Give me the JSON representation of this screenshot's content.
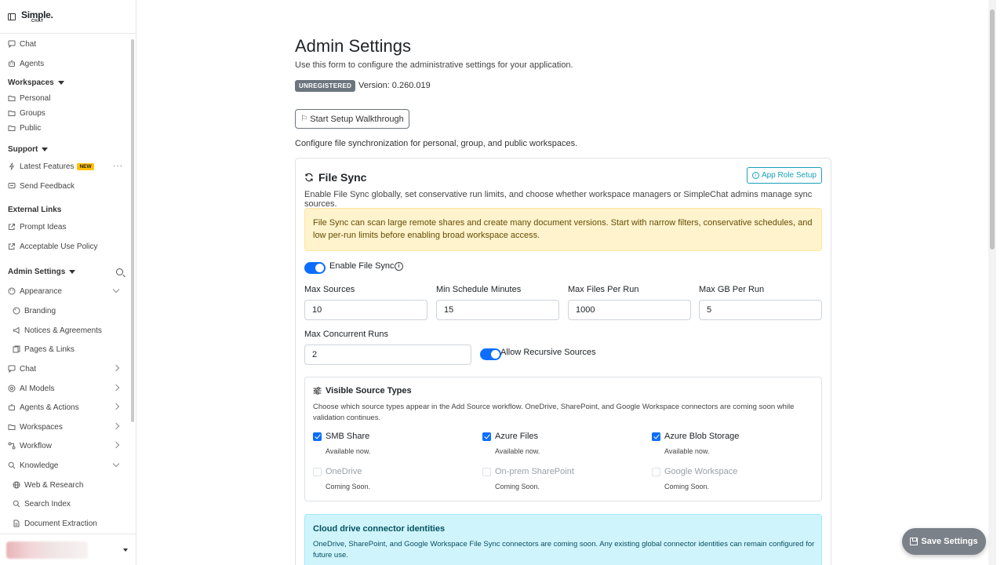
{
  "brand": {
    "line1": "Simple.",
    "line2": "CHAT"
  },
  "sidebar": {
    "chat": "Chat",
    "agents": "Agents",
    "workspaces_head": "Workspaces",
    "personal": "Personal",
    "groups": "Groups",
    "public": "Public",
    "support_head": "Support",
    "latest_features": "Latest Features",
    "new_badge": "NEW",
    "more_dots": "···",
    "send_feedback": "Send Feedback",
    "external_head": "External Links",
    "prompt_ideas": "Prompt Ideas",
    "acceptable_use": "Acceptable Use Policy",
    "admin_head": "Admin Settings",
    "appearance": "Appearance",
    "branding": "Branding",
    "notices": "Notices & Agreements",
    "pages_links": "Pages & Links",
    "admin_chat": "Chat",
    "ai_models": "AI Models",
    "agents_actions": "Agents & Actions",
    "admin_workspaces": "Workspaces",
    "workflow": "Workflow",
    "knowledge": "Knowledge",
    "web_research": "Web & Research",
    "search_index": "Search Index",
    "doc_extraction": "Document Extraction"
  },
  "header": {
    "title": "Admin Settings",
    "subtitle": "Use this form to configure the administrative settings for your application.",
    "badge": "UNREGISTERED",
    "version": "Version: 0.260.019",
    "walkthrough": "Start Setup Walkthrough",
    "config_line": "Configure file synchronization for personal, group, and public workspaces."
  },
  "filesync": {
    "title": "File Sync",
    "role_button": "App Role Setup",
    "description": "Enable File Sync globally, set conservative run limits, and choose whether workspace managers or SimpleChat admins manage sync sources.",
    "warning": "File Sync can scan large remote shares and create many document versions. Start with narrow filters, conservative schedules, and low per-run limits before enabling broad workspace access.",
    "enable_label": "Enable File Sync",
    "enabled": true,
    "max_sources_label": "Max Sources",
    "max_sources": "10",
    "min_schedule_label": "Min Schedule Minutes",
    "min_schedule": "15",
    "max_files_label": "Max Files Per Run",
    "max_files": "1000",
    "max_gb_label": "Max GB Per Run",
    "max_gb": "5",
    "max_concurrent_label": "Max Concurrent Runs",
    "max_concurrent": "2",
    "recursive_label": "Allow Recursive Sources",
    "recursive": true
  },
  "source_types": {
    "title": "Visible Source Types",
    "description": "Choose which source types appear in the Add Source workflow. OneDrive, SharePoint, and Google Workspace connectors are coming soon while validation continues.",
    "items": [
      {
        "label": "SMB Share",
        "status": "Available now.",
        "checked": true
      },
      {
        "label": "Azure Files",
        "status": "Available now.",
        "checked": true
      },
      {
        "label": "Azure Blob Storage",
        "status": "Available now.",
        "checked": true
      },
      {
        "label": "OneDrive",
        "status": "Coming Soon.",
        "checked": false
      },
      {
        "label": "On-prem SharePoint",
        "status": "Coming Soon.",
        "checked": false
      },
      {
        "label": "Google Workspace",
        "status": "Coming Soon.",
        "checked": false
      }
    ]
  },
  "cloud": {
    "title": "Cloud drive connector identities",
    "text": "OneDrive, SharePoint, and Google Workspace File Sync connectors are coming soon. Any existing global connector identities can remain configured for future use."
  },
  "save_button": "Save Settings",
  "colors": {
    "primary": "#0d6efd",
    "info": "#17a2b8",
    "warning_bg": "#fff3cd",
    "info_bg": "#cff4fc"
  }
}
